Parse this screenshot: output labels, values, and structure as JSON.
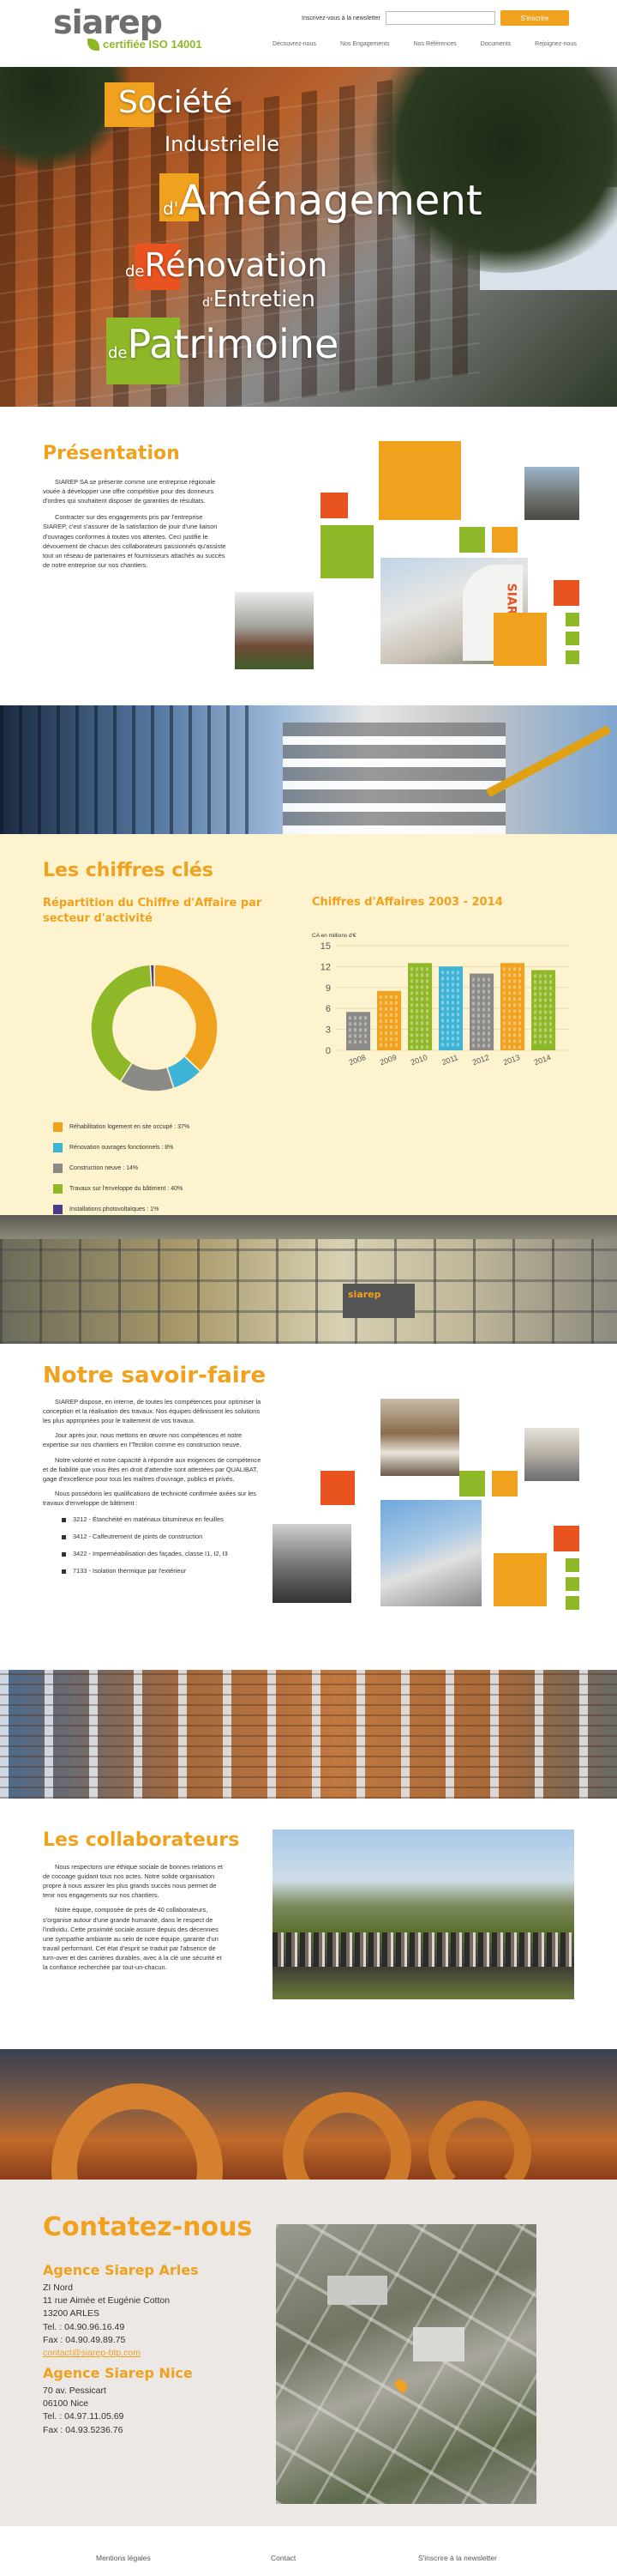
{
  "header": {
    "logo_text": "siarep",
    "logo_cert": "certifiée ISO 14001",
    "newsletter_label": "Inscrivez-vous à la newsletter",
    "newsletter_placeholder": "",
    "newsletter_button": "S'inscrire",
    "nav": [
      "Découvrez-nous",
      "Nos Engagements",
      "Nos Références",
      "Documents",
      "Rejoignez-nous"
    ]
  },
  "hero": {
    "lines": [
      {
        "first": "S",
        "rest": "ociété"
      },
      {
        "first": "",
        "rest": "Industrielle"
      },
      {
        "first": "d'",
        "rest": "Aménagement"
      },
      {
        "first": "de",
        "rest": "Rénovation"
      },
      {
        "first": "d'",
        "rest": "Entretien"
      },
      {
        "first": "de",
        "rest": "Patrimoine"
      }
    ]
  },
  "presentation": {
    "title": "Présentation",
    "p1": "SIAREP SA se présente comme une entreprise régionale vouée à développer une offre compétitive pour des donneurs d'ordres qui souhaitent disposer de garanties de résultats.",
    "p2": "Contracter sur des engagements pris par l'entreprise SIAREP, c'est s'assurer de la satisfaction de jouir d'une liaison d'ouvrages conformes à toutes vos attentes. Ceci justifie le dévouement de chacun des collaborateurs passionnés qu'assiste tout un réseau de partenaires et fournisseurs attachés au succès de notre entreprise sur nos chantiers."
  },
  "chiffres": {
    "title": "Les chiffres clés",
    "pie_title": "Répartition du Chiffre d'Affaire par secteur d'activité",
    "bar_title": "Chiffres d'Affaires 2003 - 2014",
    "bar_unit": "CA en millions d'€",
    "legend": [
      {
        "label": "Réhabilitation logement en site occupé : 37%",
        "color": "#f0a11e"
      },
      {
        "label": "Rénovation ouvrages fonctionnels : 8%",
        "color": "#3db3d6"
      },
      {
        "label": "Construction neuve : 14%",
        "color": "#8c8a86"
      },
      {
        "label": "Travaux sur l'enveloppe du bâtiment : 40%",
        "color": "#8fb829"
      },
      {
        "label": "Installations photovoltaïques : 1%",
        "color": "#4a3b8c"
      }
    ]
  },
  "chart_data": [
    {
      "type": "pie",
      "title": "Répartition du Chiffre d'Affaire par secteur d'activité",
      "categories": [
        "Réhabilitation logement en site occupé",
        "Rénovation ouvrages fonctionnels",
        "Construction neuve",
        "Travaux sur l'enveloppe du bâtiment",
        "Installations photovoltaïques"
      ],
      "values": [
        37,
        8,
        14,
        40,
        1
      ],
      "colors": [
        "#f0a11e",
        "#3db3d6",
        "#8c8a86",
        "#8fb829",
        "#4a3b8c"
      ]
    },
    {
      "type": "bar",
      "title": "Chiffres d'Affaires 2003 - 2014",
      "ylabel": "CA en millions d'€",
      "categories": [
        "2008",
        "2009",
        "2010",
        "2011",
        "2012",
        "2013",
        "2014"
      ],
      "values": [
        5.5,
        8.5,
        12.5,
        12,
        11,
        12.5,
        11.5
      ],
      "colors": [
        "#8c8a86",
        "#f0a11e",
        "#8fb829",
        "#3db3d6",
        "#8c8a86",
        "#f0a11e",
        "#8fb829"
      ],
      "ylim": [
        0,
        15
      ],
      "yticks": [
        0,
        3,
        6,
        9,
        12,
        15
      ]
    }
  ],
  "savoirfaire": {
    "title": "Notre savoir-faire",
    "p1": "SIAREP dispose, en interne, de toutes les compétences pour optimiser la conception et la réalisation des travaux. Nos équipes définissent les solutions les plus appropriées pour le traitement de vos travaux.",
    "p2": "Jour après jour, nous mettons en œuvre nos compétences et notre expertise sur nos chantiers en l'Tectilon comme en construction neuve.",
    "p3": "Notre volonté et notre capacité à répondre aux exigences de compétence et de fiabilité que vous êtes en droit d'attendre sont attestées par QUALIBAT, gage d'excellence pour tous les maîtres d'ouvrage, publics et privés.",
    "p4": "Nous possédons les qualifications de technicité confirmée axées sur les travaux d'enveloppe de bâtiment :",
    "list": [
      "3212 - Étanchéité en matériaux bitumineux en feuilles",
      "3412 - Calfeutrement de joints de construction",
      "3422 - Imperméabilisation des façades, classe I1, I2, I3",
      "7133 - Isolation thermique par l'extérieur"
    ]
  },
  "collaborateurs": {
    "title": "Les collaborateurs",
    "p1": "Nous respectons une éthique sociale de bonnes relations et de cocoage guidant tous nos actes. Notre solide organisation propre à nous assurer les plus grands succès nous permet de tenir nos engagements sur nos chantiers.",
    "p2": "Notre équipe, composée de près de 40 collaborateurs, s'organise autour d'une grande humanité, dans le respect de l'individu. Cette proximité sociale assure depuis des décennies une sympathie ambiante au sein de notre équipe, garante d'un travail performant. Cet état d'esprit se traduit par l'absence de turn-over et des carrières durables, avec à la clé une sécurité et la confiance recherchée par tout-un-chacun."
  },
  "contact": {
    "title": "Contatez-nous",
    "arles": {
      "name": "Agence Siarep Arles",
      "lines": [
        "ZI Nord",
        "11 rue Aimée et Eugénie Cotton",
        "13200 ARLES",
        "Tel. : 04.90.96.16.49",
        "Fax : 04.90.49.89.75"
      ],
      "email": "contact@siarep-btp.com"
    },
    "nice": {
      "name": "Agence Siarep Nice",
      "lines": [
        "70 av. Pessicart",
        "06100 Nice",
        "Tel. : 04.97.11.05.69",
        "Fax : 04.93.5236.76"
      ]
    }
  },
  "footer": {
    "links": [
      "Mentions légales",
      "Contact",
      "S'inscrire à la newsletter"
    ]
  },
  "colors": {
    "orange": "#f0a11e",
    "green": "#8fb829",
    "red": "#e8531f",
    "cream": "#fdf4cf"
  }
}
